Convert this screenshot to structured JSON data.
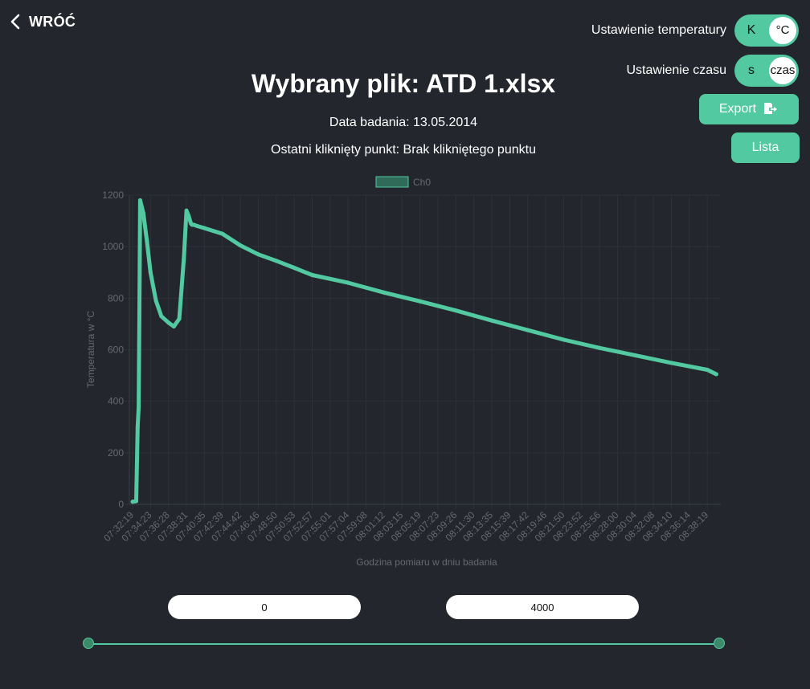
{
  "header": {
    "back_label": "WRÓĆ"
  },
  "settings": {
    "temperature": {
      "label": "Ustawienie temperatury",
      "option_left": "K",
      "option_right": "°C",
      "selected": "°C"
    },
    "time": {
      "label": "Ustawienie czasu",
      "option_left": "s",
      "option_right": "czas",
      "selected": "czas"
    }
  },
  "buttons": {
    "export_label": "Export",
    "list_label": "Lista"
  },
  "main": {
    "title": "Wybrany plik: ATD 1.xlsx",
    "date_text": "Data badania: 13.05.2014",
    "last_point_text": "Ostatni kliknięty punkt: Brak klikniętego punktu"
  },
  "range": {
    "from_value": "0",
    "to_value": "4000",
    "slider_min": 0,
    "slider_max": 4000
  },
  "colors": {
    "accent": "#52c9a0",
    "background": "#23262d",
    "grid": "#2e3238",
    "axis_text": "#666a70"
  },
  "chart_data": {
    "type": "line",
    "legend": [
      "Ch0"
    ],
    "legend_position": "top-center",
    "xlabel": "Godzina pomiaru w dniu badania",
    "ylabel": "Temperatura w °C",
    "ylim": [
      0,
      1200
    ],
    "y_ticks": [
      0,
      200,
      400,
      600,
      800,
      1000,
      1200
    ],
    "grid": true,
    "x_ticks": [
      "07:32:19",
      "07:34:23",
      "07:36:28",
      "07:38:31",
      "07:40:35",
      "07:42:39",
      "07:44:42",
      "07:46:46",
      "07:48:50",
      "07:50:53",
      "07:52:57",
      "07:55:01",
      "07:57:04",
      "07:59:08",
      "08:01:12",
      "08:03:15",
      "08:05:19",
      "08:07:23",
      "08:09:26",
      "08:11:30",
      "08:13:35",
      "08:15:39",
      "08:17:42",
      "08:19:46",
      "08:21:50",
      "08:23:52",
      "08:25:56",
      "08:28:00",
      "08:30:04",
      "08:32:08",
      "08:34:10",
      "08:36:14",
      "08:38:19"
    ],
    "series": [
      {
        "name": "Ch0",
        "x": [
          0,
          0.2,
          0.28,
          0.34,
          0.38,
          0.42,
          0.6,
          0.8,
          1.0,
          1.3,
          1.6,
          2.0,
          2.3,
          2.6,
          2.85,
          3.0,
          3.12,
          3.25,
          3.3,
          3.4,
          3.6,
          4.0,
          5.0,
          6.0,
          7.0,
          8.0,
          9.0,
          10.0,
          12.0,
          14.0,
          16.0,
          18.0,
          20.0,
          22.0,
          24.0,
          26.0,
          28.0,
          30.0,
          32.0,
          33.3
        ],
        "y": [
          10,
          12,
          300,
          380,
          760,
          1180,
          1130,
          1020,
          900,
          790,
          730,
          705,
          690,
          720,
          950,
          1140,
          1120,
          1090,
          1085,
          1085,
          1080,
          1072,
          1050,
          1005,
          970,
          945,
          918,
          890,
          860,
          822,
          788,
          752,
          713,
          676,
          639,
          607,
          578,
          549,
          522,
          505
        ]
      }
    ]
  }
}
